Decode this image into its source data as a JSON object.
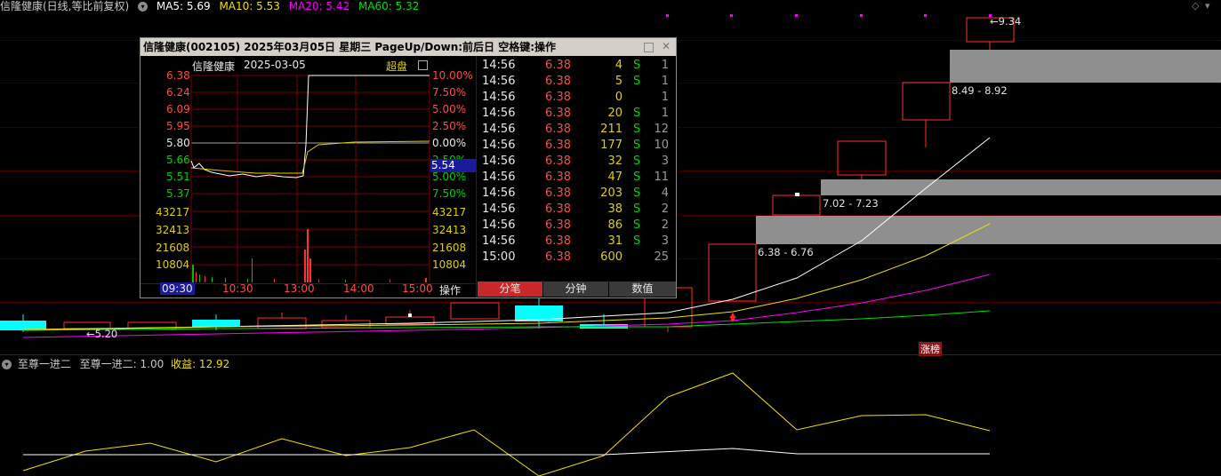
{
  "topbar": {
    "title": "信隆健康(日线,等比前复权)",
    "ma5": "MA5: 5.69",
    "ma10": "MA10: 5.53",
    "ma20": "MA20: 5.42",
    "ma60": "MA60: 5.32",
    "colors": {
      "ma5": "#ffffff",
      "ma10": "#f0e000",
      "ma20": "#ff00ff",
      "ma60": "#00e000"
    }
  },
  "annotations": {
    "high": "9.34",
    "low": "5.20",
    "limit_tag": "涨榜",
    "ranges": [
      "8.49 - 8.92",
      "7.02 - 7.23",
      "6.38 - 6.76"
    ]
  },
  "indicator": {
    "name": "至尊一进二",
    "value_label": "至尊一进二: 1.00",
    "profit_label": "收益: 12.92"
  },
  "popup": {
    "title": "信隆健康(002105)  2025年03月05日  星期三  PageUp/Down:前后日  空格键:操作",
    "mini_name": "信隆健康",
    "mini_date": "2025-03-05",
    "mini_mode": "超盘",
    "current_price": "5.54",
    "price_labels": [
      {
        "v": "6.38",
        "c": "r"
      },
      {
        "v": "6.24",
        "c": "r"
      },
      {
        "v": "6.09",
        "c": "r"
      },
      {
        "v": "5.95",
        "c": "r"
      },
      {
        "v": "5.80",
        "c": "w"
      },
      {
        "v": "5.66",
        "c": "g"
      },
      {
        "v": "5.51",
        "c": "g"
      },
      {
        "v": "5.37",
        "c": "g"
      }
    ],
    "pct_labels": [
      {
        "v": "10.00%",
        "c": "r"
      },
      {
        "v": "7.50%",
        "c": "r"
      },
      {
        "v": "5.00%",
        "c": "r"
      },
      {
        "v": "2.50%",
        "c": "r"
      },
      {
        "v": "0.00%",
        "c": "w"
      },
      {
        "v": "2.50%",
        "c": "g"
      },
      {
        "v": "5.00%",
        "c": "g"
      },
      {
        "v": "7.50%",
        "c": "g"
      }
    ],
    "vol_labels": [
      "43217",
      "32413",
      "21608",
      "10804"
    ],
    "time_labels": [
      "09:30",
      "10:30",
      "13:00",
      "14:00",
      "15:00"
    ],
    "op_button": "操作",
    "ticks": [
      {
        "t": "14:56",
        "p": "6.38",
        "v": "4",
        "s": "S",
        "n": "1"
      },
      {
        "t": "14:56",
        "p": "6.38",
        "v": "5",
        "s": "S",
        "n": "1"
      },
      {
        "t": "14:56",
        "p": "6.38",
        "v": "0",
        "s": "",
        "n": "1"
      },
      {
        "t": "14:56",
        "p": "6.38",
        "v": "20",
        "s": "S",
        "n": "1"
      },
      {
        "t": "14:56",
        "p": "6.38",
        "v": "211",
        "s": "S",
        "n": "12"
      },
      {
        "t": "14:56",
        "p": "6.38",
        "v": "177",
        "s": "S",
        "n": "10"
      },
      {
        "t": "14:56",
        "p": "6.38",
        "v": "32",
        "s": "S",
        "n": "3"
      },
      {
        "t": "14:56",
        "p": "6.38",
        "v": "47",
        "s": "S",
        "n": "11"
      },
      {
        "t": "14:56",
        "p": "6.38",
        "v": "203",
        "s": "S",
        "n": "4"
      },
      {
        "t": "14:56",
        "p": "6.38",
        "v": "38",
        "s": "S",
        "n": "2"
      },
      {
        "t": "14:56",
        "p": "6.38",
        "v": "86",
        "s": "S",
        "n": "2"
      },
      {
        "t": "14:56",
        "p": "6.38",
        "v": "31",
        "s": "S",
        "n": "3"
      },
      {
        "t": "15:00",
        "p": "6.38",
        "v": "600",
        "s": "",
        "n": "25"
      }
    ],
    "tabs": [
      "分笔",
      "分钟",
      "数值"
    ]
  }
}
